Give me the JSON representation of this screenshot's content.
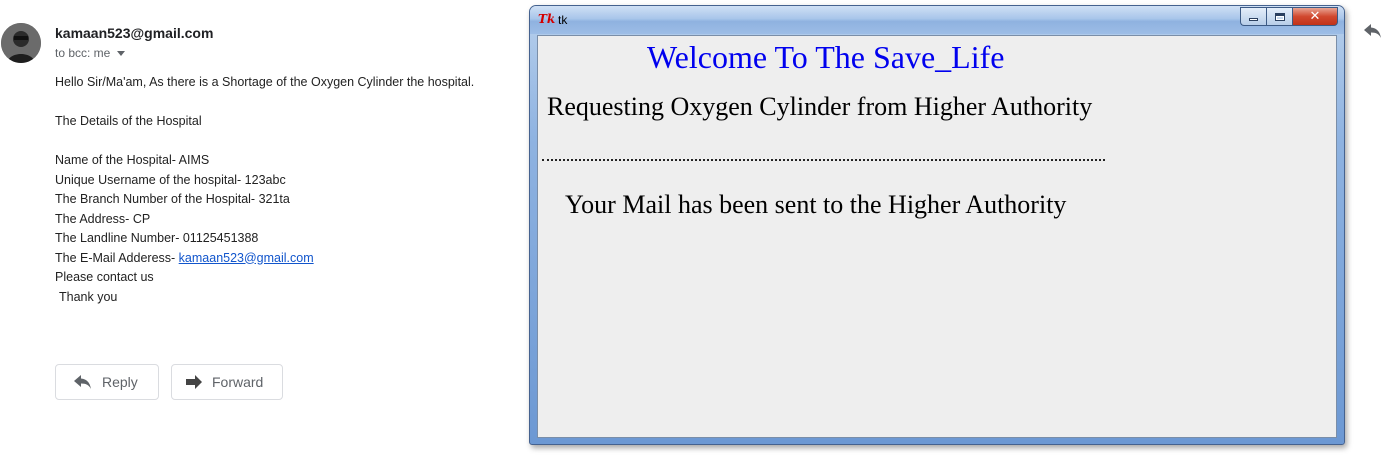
{
  "email": {
    "sender": "kamaan523@gmail.com",
    "recipients": "to bcc: me",
    "body_lines": {
      "line1": "Hello Sir/Ma'am, As there is a Shortage of the Oxygen Cylinder the hospital.",
      "line2": "The Details of the Hospital",
      "line3": "Name of the Hospital- AIMS",
      "line4": "Unique Username of the hospital- 123abc",
      "line5": "The Branch Number of the Hospital- 321ta",
      "line6": "The Address- CP",
      "line7": "The Landline Number- 01125451388",
      "line8_prefix": "The E-Mail Adderess- ",
      "line8_link": "kamaan523@gmail.com",
      "line9": "Please contact us",
      "line10": "Thank you"
    },
    "buttons": {
      "reply": "Reply",
      "forward": "Forward"
    }
  },
  "tk_window": {
    "title": "tk",
    "welcome": "Welcome To The Save_Life",
    "requesting": "Requesting Oxygen Cylinder from Higher Authority",
    "status": "Your Mail has been sent to the Higher Authority",
    "welcome_color": "#0000ee"
  }
}
